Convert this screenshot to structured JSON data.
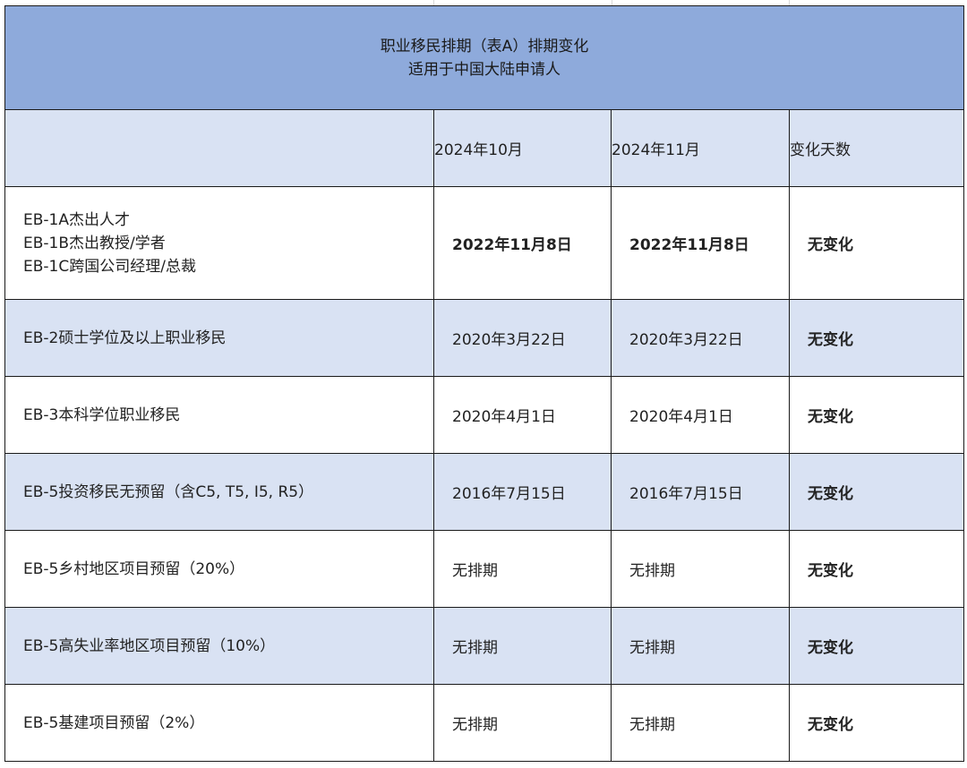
{
  "title": {
    "line1": "职业移民排期（表A）排期变化",
    "line2": "适用于中国大陆申请人"
  },
  "header": {
    "category": "",
    "col1": "2024年10月",
    "col2": "2024年11月",
    "col3": "变化天数"
  },
  "rows": [
    {
      "category_lines": [
        "EB-1A杰出人才",
        "EB-1B杰出教授/学者",
        "EB-1C跨国公司经理/总裁"
      ],
      "oct": "2022年11月8日",
      "nov": "2022年11月8日",
      "change": "无变化",
      "shaded": false
    },
    {
      "category_lines": [
        "EB-2硕士学位及以上职业移民"
      ],
      "oct": "2020年3月22日",
      "nov": "2020年3月22日",
      "change": "无变化",
      "shaded": true
    },
    {
      "category_lines": [
        "EB-3本科学位职业移民"
      ],
      "oct": "2020年4月1日",
      "nov": "2020年4月1日",
      "change": "无变化",
      "shaded": false
    },
    {
      "category_lines": [
        "EB-5投资移民无预留（含C5, T5, I5, R5）"
      ],
      "oct": "2016年7月15日",
      "nov": "2016年7月15日",
      "change": "无变化",
      "shaded": true
    },
    {
      "category_lines": [
        "EB-5乡村地区项目预留（20%）"
      ],
      "oct": "无排期",
      "nov": "无排期",
      "change": "无变化",
      "shaded": false
    },
    {
      "category_lines": [
        "EB-5高失业率地区项目预留（10%）"
      ],
      "oct": "无排期",
      "nov": "无排期",
      "change": "无变化",
      "shaded": true
    },
    {
      "category_lines": [
        "EB-5基建项目预留（2%）"
      ],
      "oct": "无排期",
      "nov": "无排期",
      "change": "无变化",
      "shaded": false
    }
  ],
  "colors": {
    "title_bg": "#8eaadb",
    "shade_bg": "#d9e2f3",
    "border": "#1a1a1a"
  }
}
